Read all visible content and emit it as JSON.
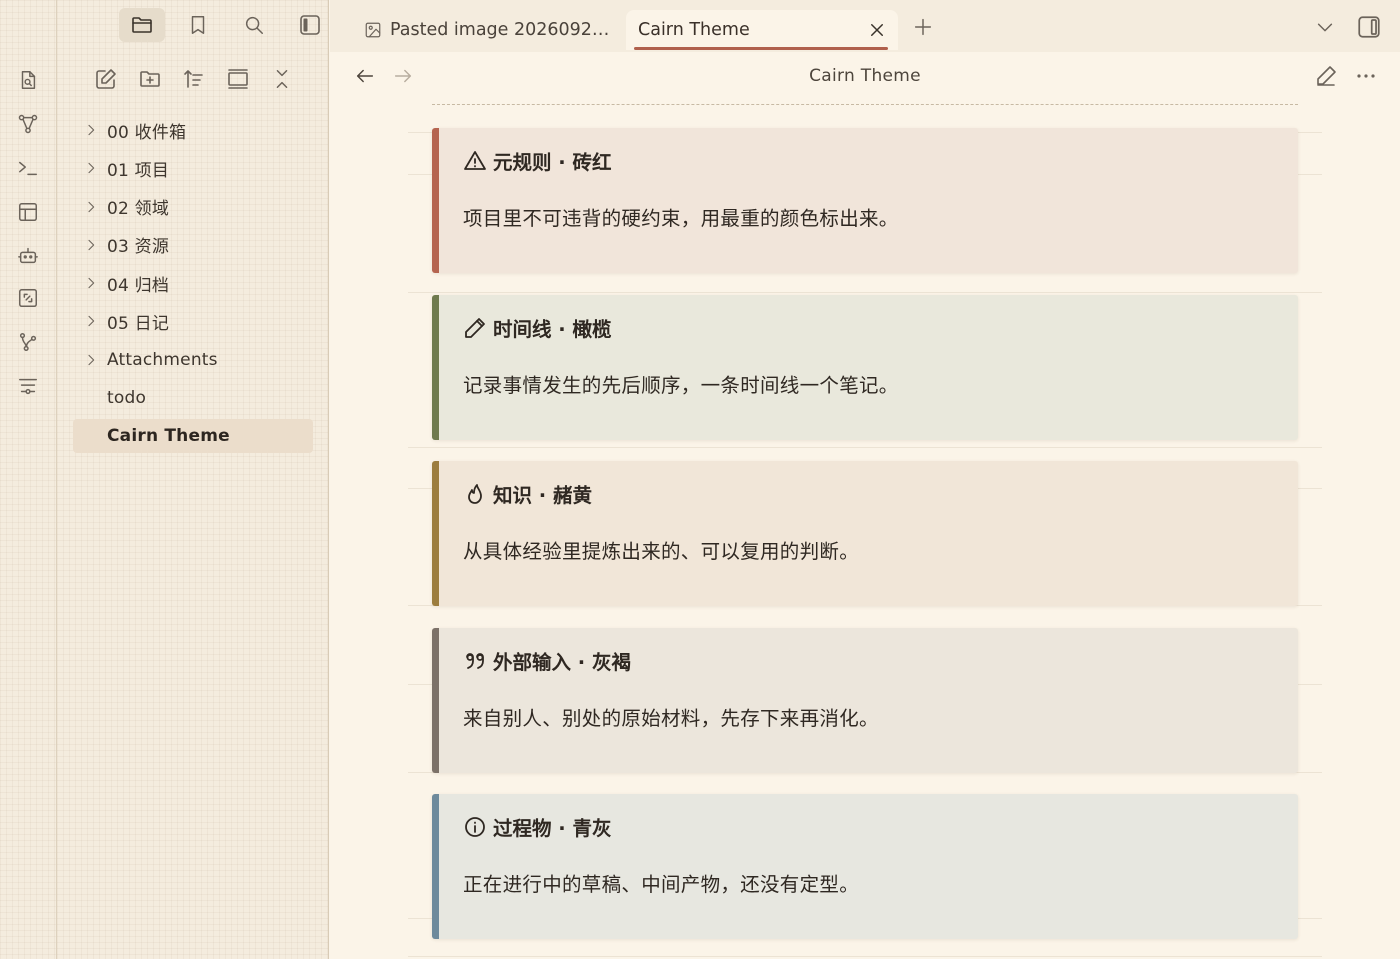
{
  "colors": {
    "brick": "#b5644f",
    "olive": "#6f7a4e",
    "ochre": "#9c7d3e",
    "taupe": "#7c7168",
    "slate": "#6e8a9c"
  },
  "ribbon": {
    "icons": [
      "search-file-icon",
      "graph-icon",
      "terminal-icon",
      "layout-icon",
      "bot-icon",
      "canvas-icon",
      "git-branch-icon",
      "filter-icon"
    ]
  },
  "sidebar": {
    "tabs": [
      "folder-icon",
      "bookmark-icon",
      "search-icon",
      "sidebar-toggle-icon"
    ],
    "actions": [
      "new-note-icon",
      "new-folder-icon",
      "sort-icon",
      "collapse-all-icon",
      "close-icon"
    ],
    "tree": [
      {
        "label": "00 收件箱",
        "type": "folder"
      },
      {
        "label": "01 项目",
        "type": "folder"
      },
      {
        "label": "02 领域",
        "type": "folder"
      },
      {
        "label": "03 资源",
        "type": "folder"
      },
      {
        "label": "04 归档",
        "type": "folder"
      },
      {
        "label": "05 日记",
        "type": "folder"
      },
      {
        "label": "Attachments",
        "type": "folder"
      },
      {
        "label": "todo",
        "type": "file"
      },
      {
        "label": "Cairn Theme",
        "type": "file",
        "selected": true
      }
    ]
  },
  "tabs": [
    {
      "label": "Pasted image 20260929...",
      "icon": "image-icon"
    },
    {
      "label": "Cairn Theme",
      "active": true
    }
  ],
  "view": {
    "title": "Cairn Theme"
  },
  "callouts": [
    {
      "title": "元规则 · 砖红",
      "body": "项目里不可违背的硬约束，用最重的颜色标出来。",
      "icon": "warning-icon",
      "accent": "#b5644f",
      "bg": "#f1e5da"
    },
    {
      "title": "时间线 · 橄榄",
      "body": "记录事情发生的先后顺序，一条时间线一个笔记。",
      "icon": "pencil-icon",
      "accent": "#6f7a4e",
      "bg": "#e9e8dc"
    },
    {
      "title": "知识 · 赭黄",
      "body": "从具体经验里提炼出来的、可以复用的判断。",
      "icon": "flame-icon",
      "accent": "#9c7d3e",
      "bg": "#f1e6d8"
    },
    {
      "title": "外部输入 · 灰褐",
      "body": "来自别人、别处的原始材料，先存下来再消化。",
      "icon": "quote-icon",
      "accent": "#7c7168",
      "bg": "#ece6dc"
    },
    {
      "title": "过程物 · 青灰",
      "body": "正在进行中的草稿、中间产物，还没有定型。",
      "icon": "info-icon",
      "accent": "#6e8a9c",
      "bg": "#e7e7e0"
    }
  ]
}
